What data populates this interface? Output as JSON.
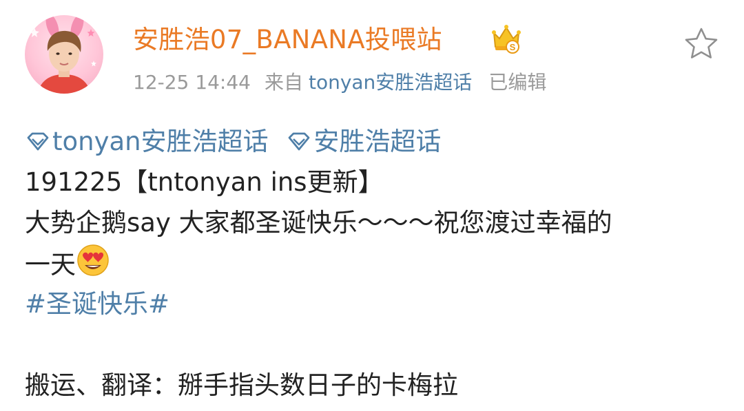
{
  "post": {
    "username": "安胜浩07_BANANA投喂站",
    "timestamp": "12-25 14:44",
    "from_label": "来自",
    "source": "tonyan安胜浩超话",
    "edited_label": "已编辑",
    "topics": [
      "tonyan安胜浩超话",
      "安胜浩超话"
    ],
    "line_date": "191225【tntonyan ins更新】",
    "line_message": "大势企鹅say 大家都圣诞快乐～～～祝您渡过幸福的",
    "line_message_end": "一天",
    "hashtag": "#圣诞快乐#",
    "credits": "搬运、翻译：掰手指头数日子的卡梅拉"
  },
  "icons": {
    "verified_badge": "crown-badge-icon",
    "favorite": "star-outline-icon",
    "topic": "diamond-icon",
    "emoji": "heart-eyes-emoji-icon"
  },
  "colors": {
    "username": "#ea7a25",
    "link": "#4f7fa8",
    "meta": "#9a9a9a",
    "text": "#222222"
  }
}
